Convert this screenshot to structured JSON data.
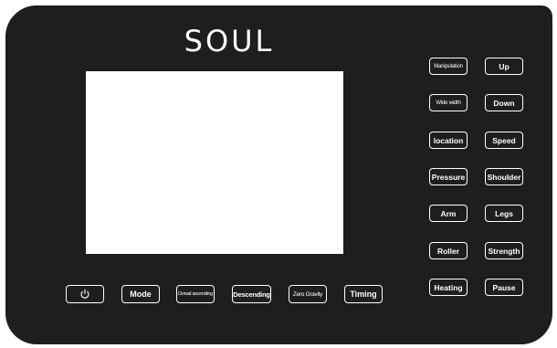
{
  "brand": {
    "name": "SOUL"
  },
  "right_buttons": {
    "manipulation": "Manipulation",
    "up": "Up",
    "wide_width": "Wide width",
    "down": "Down",
    "location": "location",
    "speed": "Speed",
    "pressure": "Pressure",
    "shoulder": "Shoulder",
    "arm": "Arm",
    "legs": "Legs",
    "roller": "Roller",
    "strength": "Strength",
    "heating": "Heating",
    "pause": "Pause"
  },
  "bottom_buttons": {
    "power_icon": "power-icon",
    "mode": "Mode",
    "dorsal_ascending": "Dorsal ascending",
    "descending": "Descending",
    "zero_gravity": "Zero Gravity",
    "timing": "Timing"
  },
  "colors": {
    "panel": "#1e1e1e",
    "screen": "#ffffff",
    "button_border": "#ffffff",
    "text": "#ffffff"
  }
}
